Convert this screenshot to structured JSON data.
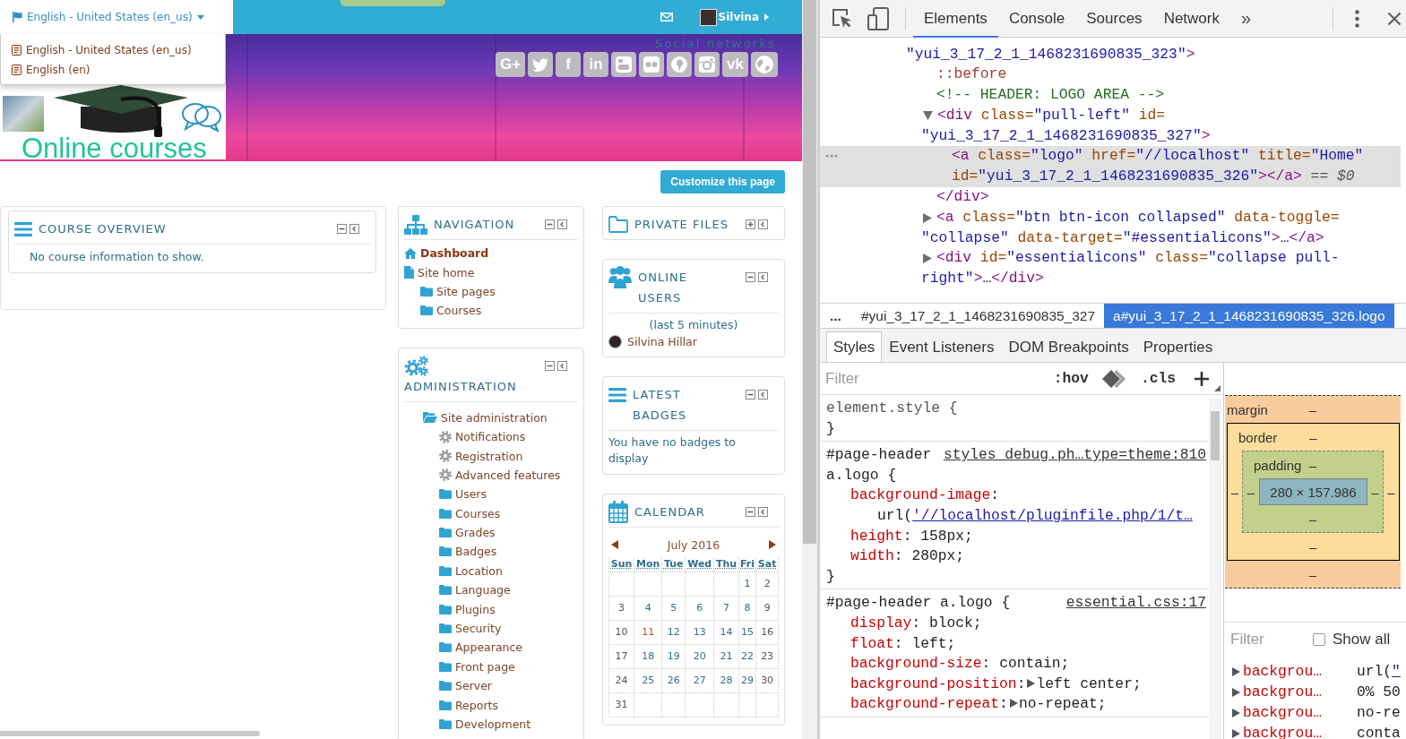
{
  "page": {
    "language_menu": {
      "label": "English - United States (en_us)",
      "expanded": true,
      "options": [
        {
          "label": "English - United States (en_us)"
        },
        {
          "label": "English (en)"
        }
      ]
    },
    "user_menu": {
      "name": "Silvina"
    },
    "logo": {
      "text": "Online courses"
    },
    "social": {
      "heading": "Social networks",
      "links": [
        {
          "kind": "glyph",
          "glyph": "G+"
        },
        {
          "kind": "bird"
        },
        {
          "kind": "glyph",
          "glyph": "f"
        },
        {
          "kind": "glyph",
          "glyph": "in"
        },
        {
          "kind": "tube"
        },
        {
          "kind": "dots"
        },
        {
          "kind": "pin"
        },
        {
          "kind": "camera"
        },
        {
          "kind": "glyph",
          "glyph": "vk"
        },
        {
          "kind": "globe"
        }
      ]
    },
    "customize_button": {
      "label": "Customize this page"
    },
    "regions": [
      {
        "blocks": [
          {
            "kind": "overview",
            "title": "COURSE OVERVIEW",
            "collapsed": false,
            "text": "No course information to show."
          }
        ]
      },
      {
        "blocks": [
          {
            "kind": "navigation",
            "title": "NAVIGATION",
            "collapsed": false,
            "items": [
              {
                "kind": "home",
                "label": "Dashboard",
                "current": true
              },
              {
                "kind": "page",
                "label": "Site home",
                "current": false,
                "children": [
                  {
                    "kind": "branch",
                    "label": "Site pages",
                    "expanded": false,
                    "current": false
                  },
                  {
                    "kind": "branch",
                    "label": "Courses",
                    "expanded": false,
                    "current": false
                  }
                ]
              }
            ]
          },
          {
            "kind": "admin",
            "title": "ADMINISTRATION",
            "collapsed": false,
            "items": [
              {
                "kind": "branch",
                "label": "Site administration",
                "expanded": true,
                "children": [
                  {
                    "kind": "setting",
                    "label": "Notifications"
                  },
                  {
                    "kind": "setting",
                    "label": "Registration"
                  },
                  {
                    "kind": "setting",
                    "label": "Advanced features"
                  },
                  {
                    "kind": "branch",
                    "label": "Users",
                    "expanded": false
                  },
                  {
                    "kind": "branch",
                    "label": "Courses",
                    "expanded": false
                  },
                  {
                    "kind": "branch",
                    "label": "Grades",
                    "expanded": false
                  },
                  {
                    "kind": "branch",
                    "label": "Badges",
                    "expanded": false
                  },
                  {
                    "kind": "branch",
                    "label": "Location",
                    "expanded": false
                  },
                  {
                    "kind": "branch",
                    "label": "Language",
                    "expanded": false
                  },
                  {
                    "kind": "branch",
                    "label": "Plugins",
                    "expanded": false
                  },
                  {
                    "kind": "branch",
                    "label": "Security",
                    "expanded": false
                  },
                  {
                    "kind": "branch",
                    "label": "Appearance",
                    "expanded": false
                  },
                  {
                    "kind": "branch",
                    "label": "Front page",
                    "expanded": false
                  },
                  {
                    "kind": "branch",
                    "label": "Server",
                    "expanded": false
                  },
                  {
                    "kind": "branch",
                    "label": "Reports",
                    "expanded": false
                  },
                  {
                    "kind": "branch",
                    "label": "Development",
                    "expanded": false
                  }
                ]
              }
            ]
          }
        ]
      },
      {
        "blocks": [
          {
            "kind": "files",
            "title": "PRIVATE FILES",
            "collapsed": true
          },
          {
            "kind": "users",
            "title": "ONLINE USERS",
            "collapsed": false,
            "note": "(last 5 minutes)",
            "users": [
              {
                "name": "Silvina Hillar"
              }
            ]
          },
          {
            "kind": "badges",
            "title": "LATEST BADGES",
            "collapsed": false,
            "text": "You have no badges to display"
          },
          {
            "kind": "calendar",
            "title": "CALENDAR",
            "collapsed": false,
            "month": "July 2016",
            "weekdays": [
              "Sun",
              "Mon",
              "Tue",
              "Wed",
              "Thu",
              "Fri",
              "Sat"
            ],
            "weeks": [
              [
                {
                  "kind": "blank"
                },
                {
                  "kind": "blank"
                },
                {
                  "kind": "blank"
                },
                {
                  "kind": "blank"
                },
                {
                  "kind": "blank"
                },
                {
                  "kind": "day",
                  "label": "1",
                  "today": false
                },
                {
                  "kind": "day",
                  "label": "2",
                  "today": false
                }
              ],
              [
                {
                  "kind": "day",
                  "label": "3",
                  "today": false
                },
                {
                  "kind": "day",
                  "label": "4",
                  "today": false
                },
                {
                  "kind": "day",
                  "label": "5",
                  "today": false
                },
                {
                  "kind": "day",
                  "label": "6",
                  "today": false
                },
                {
                  "kind": "day",
                  "label": "7",
                  "today": false
                },
                {
                  "kind": "day",
                  "label": "8",
                  "today": false
                },
                {
                  "kind": "day",
                  "label": "9",
                  "today": false
                }
              ],
              [
                {
                  "kind": "day",
                  "label": "10",
                  "today": false
                },
                {
                  "kind": "day",
                  "label": "11",
                  "today": true
                },
                {
                  "kind": "day",
                  "label": "12",
                  "today": false
                },
                {
                  "kind": "day",
                  "label": "13",
                  "today": false
                },
                {
                  "kind": "day",
                  "label": "14",
                  "today": false
                },
                {
                  "kind": "day",
                  "label": "15",
                  "today": false
                },
                {
                  "kind": "day",
                  "label": "16",
                  "today": false
                }
              ],
              [
                {
                  "kind": "day",
                  "label": "17",
                  "today": false
                },
                {
                  "kind": "day",
                  "label": "18",
                  "today": false
                },
                {
                  "kind": "day",
                  "label": "19",
                  "today": false
                },
                {
                  "kind": "day",
                  "label": "20",
                  "today": false
                },
                {
                  "kind": "day",
                  "label": "21",
                  "today": false
                },
                {
                  "kind": "day",
                  "label": "22",
                  "today": false
                },
                {
                  "kind": "day",
                  "label": "23",
                  "today": false
                }
              ],
              [
                {
                  "kind": "day",
                  "label": "24",
                  "today": false
                },
                {
                  "kind": "day",
                  "label": "25",
                  "today": false
                },
                {
                  "kind": "day",
                  "label": "26",
                  "today": false
                },
                {
                  "kind": "day",
                  "label": "27",
                  "today": false
                },
                {
                  "kind": "day",
                  "label": "28",
                  "today": false
                },
                {
                  "kind": "day",
                  "label": "29",
                  "today": false
                },
                {
                  "kind": "day",
                  "label": "30",
                  "today": false
                }
              ],
              [
                {
                  "kind": "day",
                  "label": "31",
                  "today": false
                },
                {
                  "kind": "blank"
                },
                {
                  "kind": "blank"
                },
                {
                  "kind": "blank"
                },
                {
                  "kind": "blank"
                },
                {
                  "kind": "blank"
                },
                {
                  "kind": "blank"
                }
              ]
            ]
          }
        ]
      }
    ]
  },
  "devtools": {
    "tabs": [
      {
        "label": "Elements",
        "selected": true
      },
      {
        "label": "Console",
        "selected": false
      },
      {
        "label": "Sources",
        "selected": false
      },
      {
        "label": "Network",
        "selected": false
      }
    ],
    "more_tabs": "»",
    "dom": {
      "continued": true,
      "selected": false,
      "lines": [
        [
          {
            "kind": "value",
            "text": "\"yui_3_17_2_1_1468231690835_323\""
          },
          {
            "kind": "tag",
            "text": ">"
          }
        ]
      ],
      "children": [
        {
          "selected": false,
          "lines": [
            [
              {
                "kind": "pseudo",
                "text": "::before"
              }
            ]
          ]
        },
        {
          "selected": false,
          "lines": [
            [
              {
                "kind": "comment",
                "text": "<!-- HEADER: LOGO AREA -->"
              }
            ]
          ]
        },
        {
          "expanded": true,
          "selected": false,
          "lines": [
            [
              {
                "kind": "tag",
                "text": "<div"
              },
              {
                "kind": "attr",
                "text": " class"
              },
              {
                "kind": "punct",
                "text": "="
              },
              {
                "kind": "value",
                "text": "\"pull-left\""
              },
              {
                "kind": "attr",
                "text": " id"
              },
              {
                "kind": "punct",
                "text": "="
              }
            ],
            [
              {
                "kind": "value",
                "text": "\"yui_3_17_2_1_1468231690835_327\""
              },
              {
                "kind": "tag",
                "text": ">"
              }
            ]
          ],
          "children": [
            {
              "selected": true,
              "lines": [
                [
                  {
                    "kind": "tag",
                    "text": "<a"
                  },
                  {
                    "kind": "attr",
                    "text": " class"
                  },
                  {
                    "kind": "punct",
                    "text": "="
                  },
                  {
                    "kind": "value",
                    "text": "\"logo\""
                  },
                  {
                    "kind": "attr",
                    "text": " href"
                  },
                  {
                    "kind": "punct",
                    "text": "="
                  },
                  {
                    "kind": "value",
                    "text": "\"//localhost\""
                  },
                  {
                    "kind": "attr",
                    "text": " title"
                  },
                  {
                    "kind": "punct",
                    "text": "="
                  },
                  {
                    "kind": "value",
                    "text": "\"Home\""
                  }
                ],
                [
                  {
                    "kind": "attr",
                    "text": "id"
                  },
                  {
                    "kind": "punct",
                    "text": "="
                  },
                  {
                    "kind": "value",
                    "text": "\"yui_3_17_2_1_1468231690835_326\""
                  },
                  {
                    "kind": "tag",
                    "text": "></a>"
                  },
                  {
                    "kind": "hint",
                    "text": " == $0"
                  }
                ]
              ]
            }
          ],
          "closing": [
            {
              "kind": "tag",
              "text": "</div>"
            }
          ]
        },
        {
          "expanded": false,
          "selected": false,
          "lines": [
            [
              {
                "kind": "tag",
                "text": "<a"
              },
              {
                "kind": "attr",
                "text": " class"
              },
              {
                "kind": "punct",
                "text": "="
              },
              {
                "kind": "value",
                "text": "\"btn btn-icon collapsed\""
              },
              {
                "kind": "attr",
                "text": " data-toggle"
              },
              {
                "kind": "punct",
                "text": "="
              }
            ],
            [
              {
                "kind": "value",
                "text": "\"collapse\""
              },
              {
                "kind": "attr",
                "text": " data-target"
              },
              {
                "kind": "punct",
                "text": "="
              },
              {
                "kind": "value",
                "text": "\"#essentialicons\""
              },
              {
                "kind": "tag",
                "text": ">"
              },
              {
                "kind": "text",
                "text": "…"
              },
              {
                "kind": "tag",
                "text": "</a>"
              }
            ]
          ]
        },
        {
          "expanded": false,
          "selected": false,
          "lines": [
            [
              {
                "kind": "tag",
                "text": "<div"
              },
              {
                "kind": "attr",
                "text": " id"
              },
              {
                "kind": "punct",
                "text": "="
              },
              {
                "kind": "value",
                "text": "\"essentialicons\""
              },
              {
                "kind": "attr",
                "text": " class"
              },
              {
                "kind": "punct",
                "text": "="
              },
              {
                "kind": "value",
                "text": "\"collapse pull-"
              }
            ],
            [
              {
                "kind": "value",
                "text": "right\""
              },
              {
                "kind": "tag",
                "text": ">"
              },
              {
                "kind": "text",
                "text": "…"
              },
              {
                "kind": "tag",
                "text": "</div>"
              }
            ]
          ]
        }
      ]
    },
    "breadcrumb_overflow": "...",
    "breadcrumbs": [
      {
        "label": "#yui_3_17_2_1_1468231690835_327",
        "selected": false
      },
      {
        "label": "a#yui_3_17_2_1_1468231690835_326.logo",
        "selected": true
      }
    ],
    "subtabs": [
      {
        "label": "Styles",
        "selected": true
      },
      {
        "label": "Event Listeners",
        "selected": false
      },
      {
        "label": "DOM Breakpoints",
        "selected": false
      },
      {
        "label": "Properties",
        "selected": false
      }
    ],
    "styles": {
      "filter_placeholder": "Filter",
      "hov": ":hov",
      "cls": ".cls",
      "rules": [
        {
          "kind": "inline",
          "selector": "element.style {",
          "closing": "}"
        },
        {
          "kind": "matched",
          "selector": "#page-header a.logo {",
          "source": "styles_debug.ph…type=theme:810",
          "declarations": [
            {
              "kind": "url",
              "property": "background-image",
              "punct": ":",
              "value": "url(",
              "link": "'//localhost/pluginfile.php/1/t…"
            },
            {
              "kind": "plain",
              "property": "height",
              "punct": ":",
              "value": "158px;"
            },
            {
              "kind": "plain",
              "property": "width",
              "punct": ":",
              "value": "280px;"
            }
          ],
          "closing": "}"
        },
        {
          "kind": "matched",
          "selector": "#page-header a.logo {",
          "source": "essential.css:17",
          "declarations": [
            {
              "kind": "plain",
              "property": "display",
              "punct": ":",
              "value": "block;"
            },
            {
              "kind": "plain",
              "property": "float",
              "punct": ":",
              "value": "left;"
            },
            {
              "kind": "plain",
              "property": "background-size",
              "punct": ":",
              "value": "contain;"
            },
            {
              "kind": "shorthand",
              "property": "background-position",
              "punct": ":",
              "value": "left center;"
            },
            {
              "kind": "shorthand",
              "property": "background-repeat",
              "punct": ":",
              "value": "no-repeat;"
            }
          ]
        }
      ]
    },
    "box_model": {
      "margin": {
        "label": "margin",
        "top": "–",
        "bottom": "–"
      },
      "border": {
        "label": "border",
        "top": "–",
        "right": "–",
        "bottom": "–",
        "left": "–"
      },
      "padding": {
        "label": "padding",
        "top": "–",
        "right": "–",
        "bottom": "–",
        "left": "–"
      },
      "content": "280 × 157.986"
    },
    "computed": {
      "filter_placeholder": "Filter",
      "show_all": {
        "label": "Show all",
        "checked": false
      },
      "rows": [
        {
          "expanded": false,
          "property": "backgrou…",
          "value": "url(",
          "link": "\""
        },
        {
          "expanded": false,
          "property": "backgrou…",
          "value": "0% 50"
        },
        {
          "expanded": false,
          "property": "backgrou…",
          "value": "no-re"
        },
        {
          "expanded": false,
          "property": "backgrou…",
          "value": "conta"
        }
      ]
    }
  }
}
